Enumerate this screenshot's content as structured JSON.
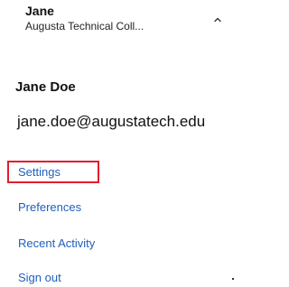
{
  "header": {
    "name": "Jane",
    "organization": "Augusta Technical Coll...",
    "toggle_icon": "chevron-up-icon"
  },
  "profile": {
    "name": "Jane Doe",
    "email": "jane.doe@augustatech.edu"
  },
  "menu": {
    "settings": "Settings",
    "preferences": "Preferences",
    "recent_activity": "Recent Activity",
    "sign_out": "Sign out"
  },
  "colors": {
    "link": "#1f5fbf",
    "highlight": "#e21d2e"
  }
}
